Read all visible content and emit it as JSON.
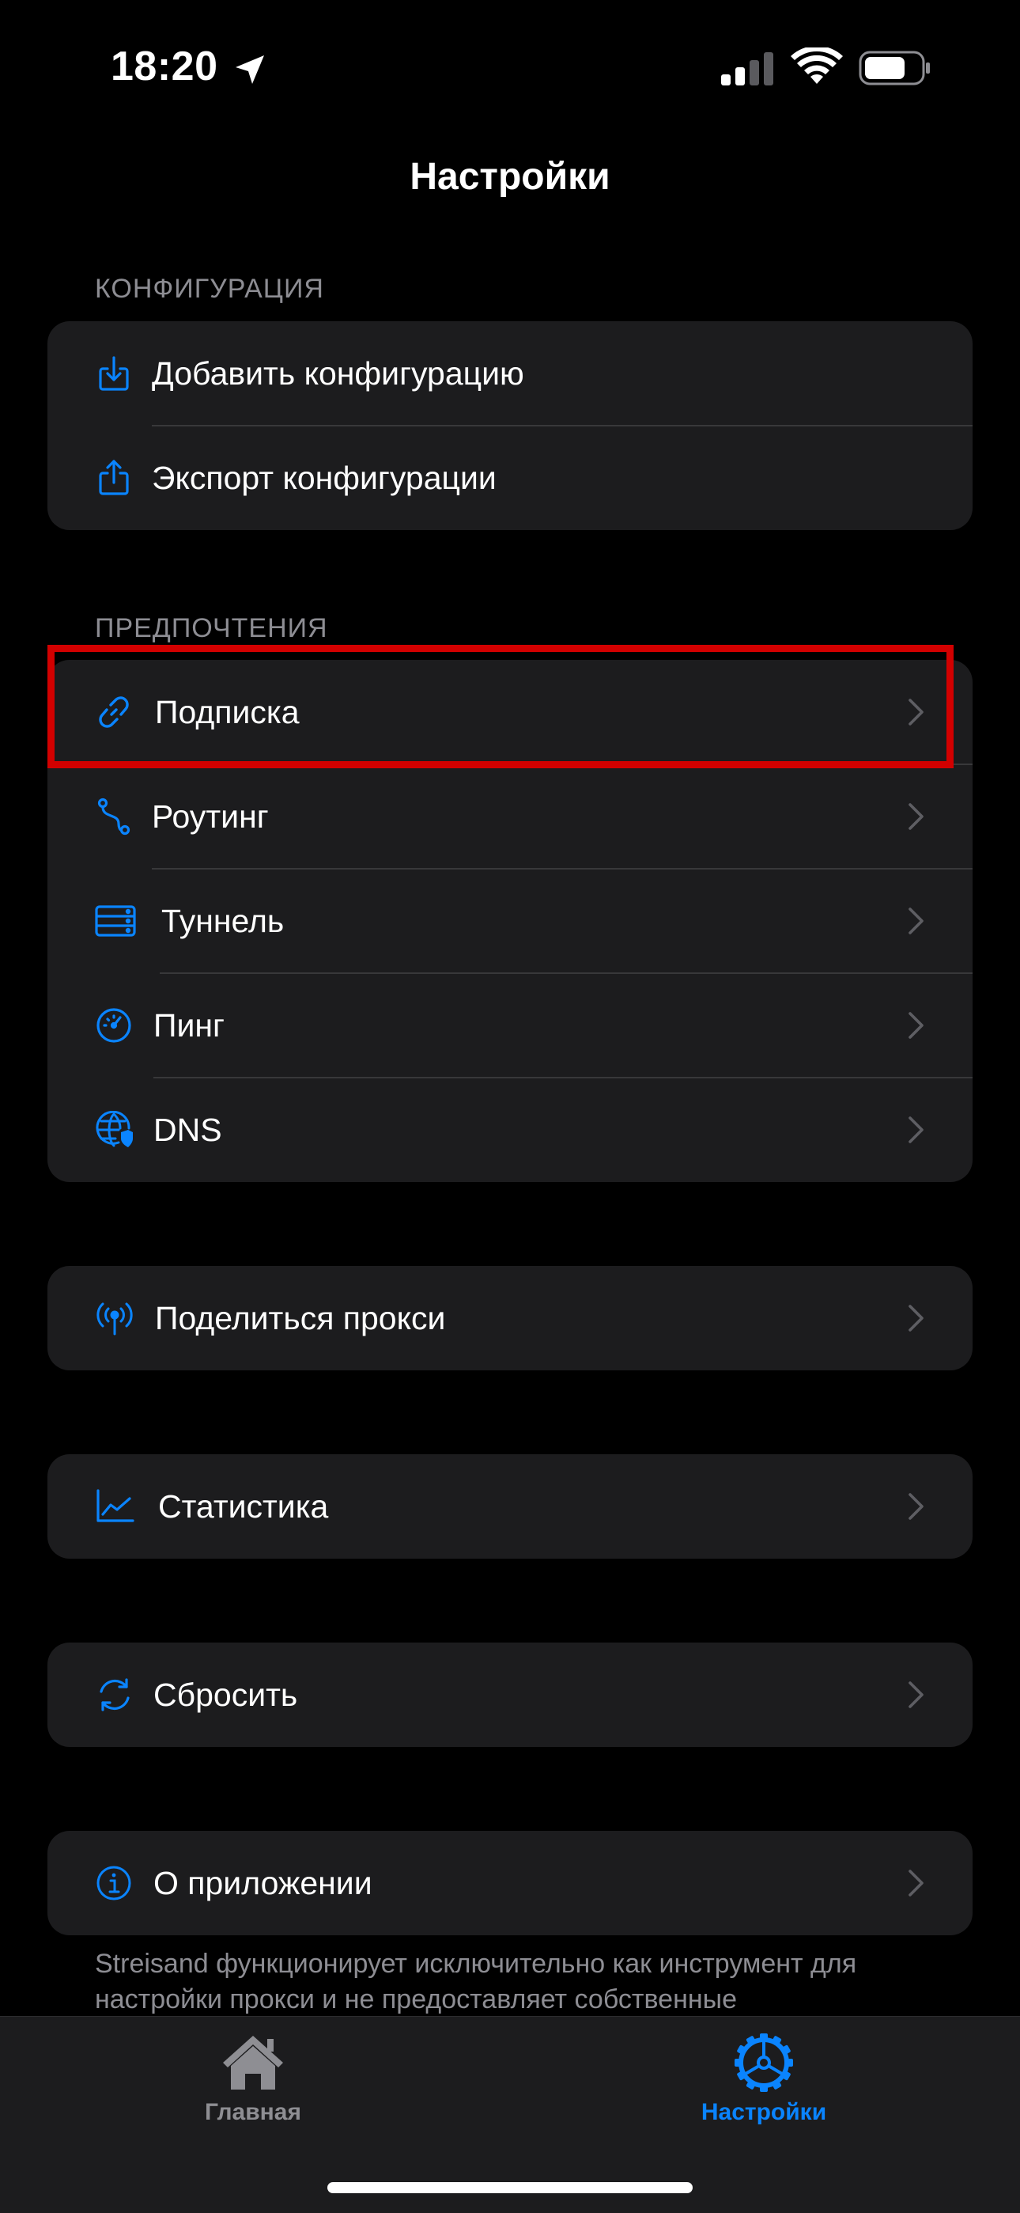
{
  "status_bar": {
    "time": "18:20"
  },
  "header": {
    "title": "Настройки"
  },
  "sections": {
    "configuration": {
      "header": "КОНФИГУРАЦИЯ",
      "items": [
        {
          "label": "Добавить конфигурацию",
          "icon": "import-icon"
        },
        {
          "label": "Экспорт конфигурации",
          "icon": "share-icon"
        }
      ]
    },
    "preferences": {
      "header": "ПРЕДПОЧТЕНИЯ",
      "items": [
        {
          "label": "Подписка",
          "icon": "link-icon"
        },
        {
          "label": "Роутинг",
          "icon": "route-icon"
        },
        {
          "label": "Туннель",
          "icon": "server-icon"
        },
        {
          "label": "Пинг",
          "icon": "gauge-icon"
        },
        {
          "label": "DNS",
          "icon": "globe-shield-icon"
        }
      ]
    },
    "share_proxy": {
      "label": "Поделиться прокси",
      "icon": "antenna-icon"
    },
    "statistics": {
      "label": "Статистика",
      "icon": "chart-icon"
    },
    "reset": {
      "label": "Сбросить",
      "icon": "refresh-icon"
    },
    "about": {
      "label": "О приложении",
      "icon": "info-icon"
    }
  },
  "footer": {
    "text": "Streisand функционирует исключительно как инструмент для настройки прокси и не предоставляет собственные"
  },
  "tabbar": {
    "tabs": [
      {
        "label": "Главная",
        "icon": "house-icon",
        "active": false
      },
      {
        "label": "Настройки",
        "icon": "gear-icon",
        "active": true
      }
    ]
  },
  "colors": {
    "accent": "#0a84ff",
    "background": "#000000",
    "group_background": "#1c1c1e",
    "secondary_text": "#8d8d93",
    "highlight": "#d20000",
    "inactive_tab": "#8e8e93"
  }
}
